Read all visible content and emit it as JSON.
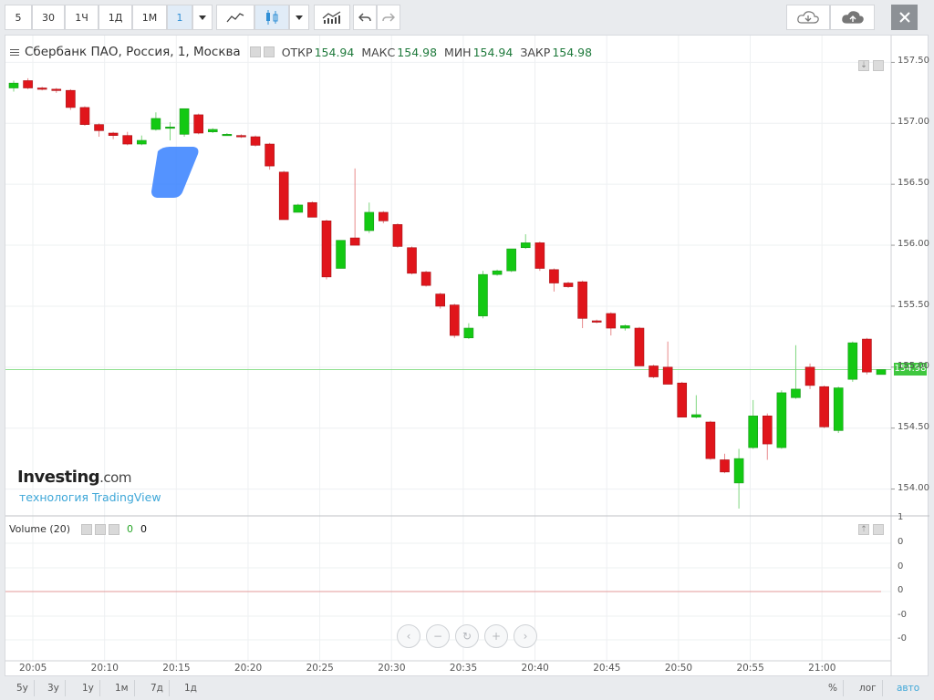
{
  "toolbar": {
    "intervals": [
      "5",
      "30",
      "1Ч",
      "1Д",
      "1М"
    ],
    "selected_interval": "1",
    "colors": {
      "accent": "#2f8fd6",
      "up": "#13c913",
      "down": "#e0151b"
    }
  },
  "legend": {
    "symbol": "Сбербанк ПАО, Россия, 1, Москва",
    "open_label": "ОТКР",
    "open": "154.94",
    "high_label": "МАКС",
    "high": "154.98",
    "low_label": "МИН",
    "low": "154.94",
    "close_label": "ЗАКР",
    "close": "154.98"
  },
  "volume_legend": {
    "label": "Volume (20)",
    "v1": "0",
    "v2": "0"
  },
  "watermark": {
    "brand": "Investing",
    "brand_suffix": ".com",
    "sub": "технология TradingView"
  },
  "price_tag": "154.98",
  "y_axis": [
    "157.50",
    "157.00",
    "156.50",
    "156.00",
    "155.50",
    "155.00",
    "154.50",
    "154.00"
  ],
  "vol_axis": [
    "1",
    "0",
    "0",
    "0",
    "-0",
    "-0"
  ],
  "x_axis": [
    "20:05",
    "20:10",
    "20:15",
    "20:20",
    "20:25",
    "20:30",
    "20:35",
    "20:40",
    "20:45",
    "20:50",
    "20:55",
    "21:00"
  ],
  "range_buttons": [
    "5у",
    "3у",
    "1у",
    "1м",
    "7д",
    "1д"
  ],
  "scale_buttons": [
    "%",
    "лог",
    "авто"
  ],
  "chart_data": {
    "type": "candlestick",
    "x_ticks": [
      "20:05",
      "20:10",
      "20:15",
      "20:20",
      "20:25",
      "20:30",
      "20:35",
      "20:40",
      "20:45",
      "20:50",
      "20:55",
      "21:00"
    ],
    "ylim": [
      153.78,
      157.72
    ],
    "last_price": 154.98,
    "candles": [
      {
        "o": 157.29,
        "h": 157.35,
        "l": 157.26,
        "c": 157.33
      },
      {
        "o": 157.35,
        "h": 157.37,
        "l": 157.28,
        "c": 157.29
      },
      {
        "o": 157.29,
        "h": 157.3,
        "l": 157.27,
        "c": 157.28
      },
      {
        "o": 157.28,
        "h": 157.29,
        "l": 157.25,
        "c": 157.27
      },
      {
        "o": 157.27,
        "h": 157.28,
        "l": 157.11,
        "c": 157.13
      },
      {
        "o": 157.13,
        "h": 157.14,
        "l": 156.98,
        "c": 156.99
      },
      {
        "o": 156.99,
        "h": 157.0,
        "l": 156.89,
        "c": 156.94
      },
      {
        "o": 156.92,
        "h": 156.93,
        "l": 156.87,
        "c": 156.9
      },
      {
        "o": 156.9,
        "h": 156.93,
        "l": 156.82,
        "c": 156.83
      },
      {
        "o": 156.83,
        "h": 156.9,
        "l": 156.82,
        "c": 156.86
      },
      {
        "o": 156.95,
        "h": 157.09,
        "l": 156.94,
        "c": 157.04
      },
      {
        "o": 156.96,
        "h": 157.01,
        "l": 156.86,
        "c": 156.97
      },
      {
        "o": 156.91,
        "h": 157.12,
        "l": 156.89,
        "c": 157.12
      },
      {
        "o": 157.07,
        "h": 157.08,
        "l": 156.91,
        "c": 156.92
      },
      {
        "o": 156.93,
        "h": 156.96,
        "l": 156.92,
        "c": 156.95
      },
      {
        "o": 156.91,
        "h": 156.92,
        "l": 156.9,
        "c": 156.91
      },
      {
        "o": 156.9,
        "h": 156.91,
        "l": 156.88,
        "c": 156.89
      },
      {
        "o": 156.89,
        "h": 156.9,
        "l": 156.81,
        "c": 156.82
      },
      {
        "o": 156.83,
        "h": 156.84,
        "l": 156.62,
        "c": 156.65
      },
      {
        "o": 156.6,
        "h": 156.61,
        "l": 156.21,
        "c": 156.21
      },
      {
        "o": 156.27,
        "h": 156.34,
        "l": 156.29,
        "c": 156.33
      },
      {
        "o": 156.35,
        "h": 156.36,
        "l": 156.23,
        "c": 156.23
      },
      {
        "o": 156.2,
        "h": 156.21,
        "l": 155.72,
        "c": 155.74
      },
      {
        "o": 155.81,
        "h": 156.04,
        "l": 155.81,
        "c": 156.04
      },
      {
        "o": 156.06,
        "h": 156.63,
        "l": 156.0,
        "c": 156.0
      },
      {
        "o": 156.12,
        "h": 156.35,
        "l": 156.1,
        "c": 156.27
      },
      {
        "o": 156.27,
        "h": 156.28,
        "l": 156.18,
        "c": 156.2
      },
      {
        "o": 156.17,
        "h": 156.18,
        "l": 155.98,
        "c": 155.99
      },
      {
        "o": 155.98,
        "h": 155.99,
        "l": 155.76,
        "c": 155.77
      },
      {
        "o": 155.78,
        "h": 155.79,
        "l": 155.66,
        "c": 155.67
      },
      {
        "o": 155.6,
        "h": 155.61,
        "l": 155.48,
        "c": 155.5
      },
      {
        "o": 155.51,
        "h": 155.52,
        "l": 155.24,
        "c": 155.26
      },
      {
        "o": 155.24,
        "h": 155.36,
        "l": 155.23,
        "c": 155.32
      },
      {
        "o": 155.42,
        "h": 155.79,
        "l": 155.4,
        "c": 155.76
      },
      {
        "o": 155.76,
        "h": 155.8,
        "l": 155.75,
        "c": 155.79
      },
      {
        "o": 155.79,
        "h": 155.97,
        "l": 155.78,
        "c": 155.97
      },
      {
        "o": 155.98,
        "h": 156.09,
        "l": 155.97,
        "c": 156.02
      },
      {
        "o": 156.02,
        "h": 156.03,
        "l": 155.79,
        "c": 155.81
      },
      {
        "o": 155.8,
        "h": 155.81,
        "l": 155.62,
        "c": 155.69
      },
      {
        "o": 155.69,
        "h": 155.7,
        "l": 155.65,
        "c": 155.66
      },
      {
        "o": 155.7,
        "h": 155.71,
        "l": 155.32,
        "c": 155.4
      },
      {
        "o": 155.38,
        "h": 155.39,
        "l": 155.36,
        "c": 155.37
      },
      {
        "o": 155.44,
        "h": 155.45,
        "l": 155.26,
        "c": 155.32
      },
      {
        "o": 155.32,
        "h": 155.35,
        "l": 155.3,
        "c": 155.34
      },
      {
        "o": 155.32,
        "h": 155.33,
        "l": 155.01,
        "c": 155.01
      },
      {
        "o": 155.01,
        "h": 155.02,
        "l": 154.91,
        "c": 154.92
      },
      {
        "o": 155.0,
        "h": 155.21,
        "l": 154.86,
        "c": 154.86
      },
      {
        "o": 154.87,
        "h": 154.88,
        "l": 154.59,
        "c": 154.59
      },
      {
        "o": 154.59,
        "h": 154.77,
        "l": 154.58,
        "c": 154.61
      },
      {
        "o": 154.55,
        "h": 154.56,
        "l": 154.24,
        "c": 154.25
      },
      {
        "o": 154.24,
        "h": 154.29,
        "l": 154.13,
        "c": 154.14
      },
      {
        "o": 154.05,
        "h": 154.33,
        "l": 153.84,
        "c": 154.25
      },
      {
        "o": 154.34,
        "h": 154.73,
        "l": 154.33,
        "c": 154.6
      },
      {
        "o": 154.6,
        "h": 154.62,
        "l": 154.24,
        "c": 154.37
      },
      {
        "o": 154.34,
        "h": 154.81,
        "l": 154.33,
        "c": 154.79
      },
      {
        "o": 154.75,
        "h": 155.18,
        "l": 154.74,
        "c": 154.82
      },
      {
        "o": 155.0,
        "h": 155.03,
        "l": 154.82,
        "c": 154.85
      },
      {
        "o": 154.84,
        "h": 154.85,
        "l": 154.5,
        "c": 154.51
      },
      {
        "o": 154.48,
        "h": 154.84,
        "l": 154.46,
        "c": 154.83
      },
      {
        "o": 154.9,
        "h": 155.21,
        "l": 154.88,
        "c": 155.2
      },
      {
        "o": 155.23,
        "h": 155.24,
        "l": 154.94,
        "c": 154.96
      },
      {
        "o": 154.94,
        "h": 154.98,
        "l": 154.94,
        "c": 154.98
      }
    ],
    "volume_series": {
      "name": "Volume (20)",
      "values": [
        0
      ]
    }
  }
}
